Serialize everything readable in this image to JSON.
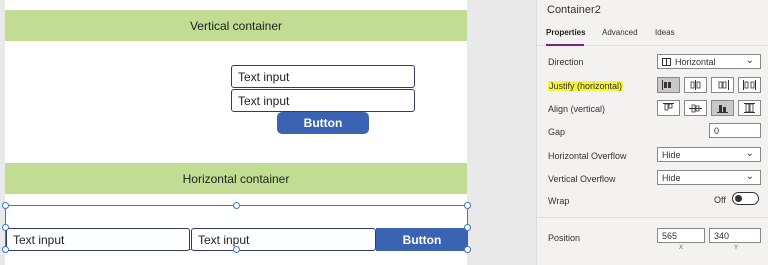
{
  "canvas": {
    "vertical_banner": "Vertical container",
    "vertical_inputs": [
      "Text input",
      "Text input"
    ],
    "vertical_button": "Button",
    "horizontal_banner": "Horizontal container",
    "horizontal_inputs": [
      "Text input",
      "Text input"
    ],
    "horizontal_button": "Button"
  },
  "panel": {
    "title": "Container2",
    "tabs": [
      "Properties",
      "Advanced",
      "Ideas"
    ],
    "active_tab": "Properties",
    "direction": {
      "label": "Direction",
      "value": "Horizontal",
      "icon": "horizontal-layout-icon"
    },
    "justify": {
      "label": "Justify (horizontal)",
      "options": [
        "justify-start-icon",
        "justify-center-icon",
        "justify-end-icon",
        "justify-space-between-icon"
      ],
      "selected": 0
    },
    "align": {
      "label": "Align (vertical)",
      "options": [
        "align-top-icon",
        "align-center-icon",
        "align-bottom-icon",
        "align-stretch-icon"
      ],
      "selected": 2
    },
    "gap": {
      "label": "Gap",
      "value": "0"
    },
    "horizontal_overflow": {
      "label": "Horizontal Overflow",
      "value": "Hide"
    },
    "vertical_overflow": {
      "label": "Vertical Overflow",
      "value": "Hide"
    },
    "wrap": {
      "label": "Wrap",
      "state": "Off"
    },
    "position": {
      "label": "Position",
      "x": "565",
      "y": "340",
      "x_label": "X",
      "y_label": "Y"
    }
  },
  "colors": {
    "banner": "#c0dd93",
    "button": "#3a63b3",
    "selection": "#3a78c9",
    "highlight": "#f7f23a",
    "tab_accent": "#742774"
  }
}
